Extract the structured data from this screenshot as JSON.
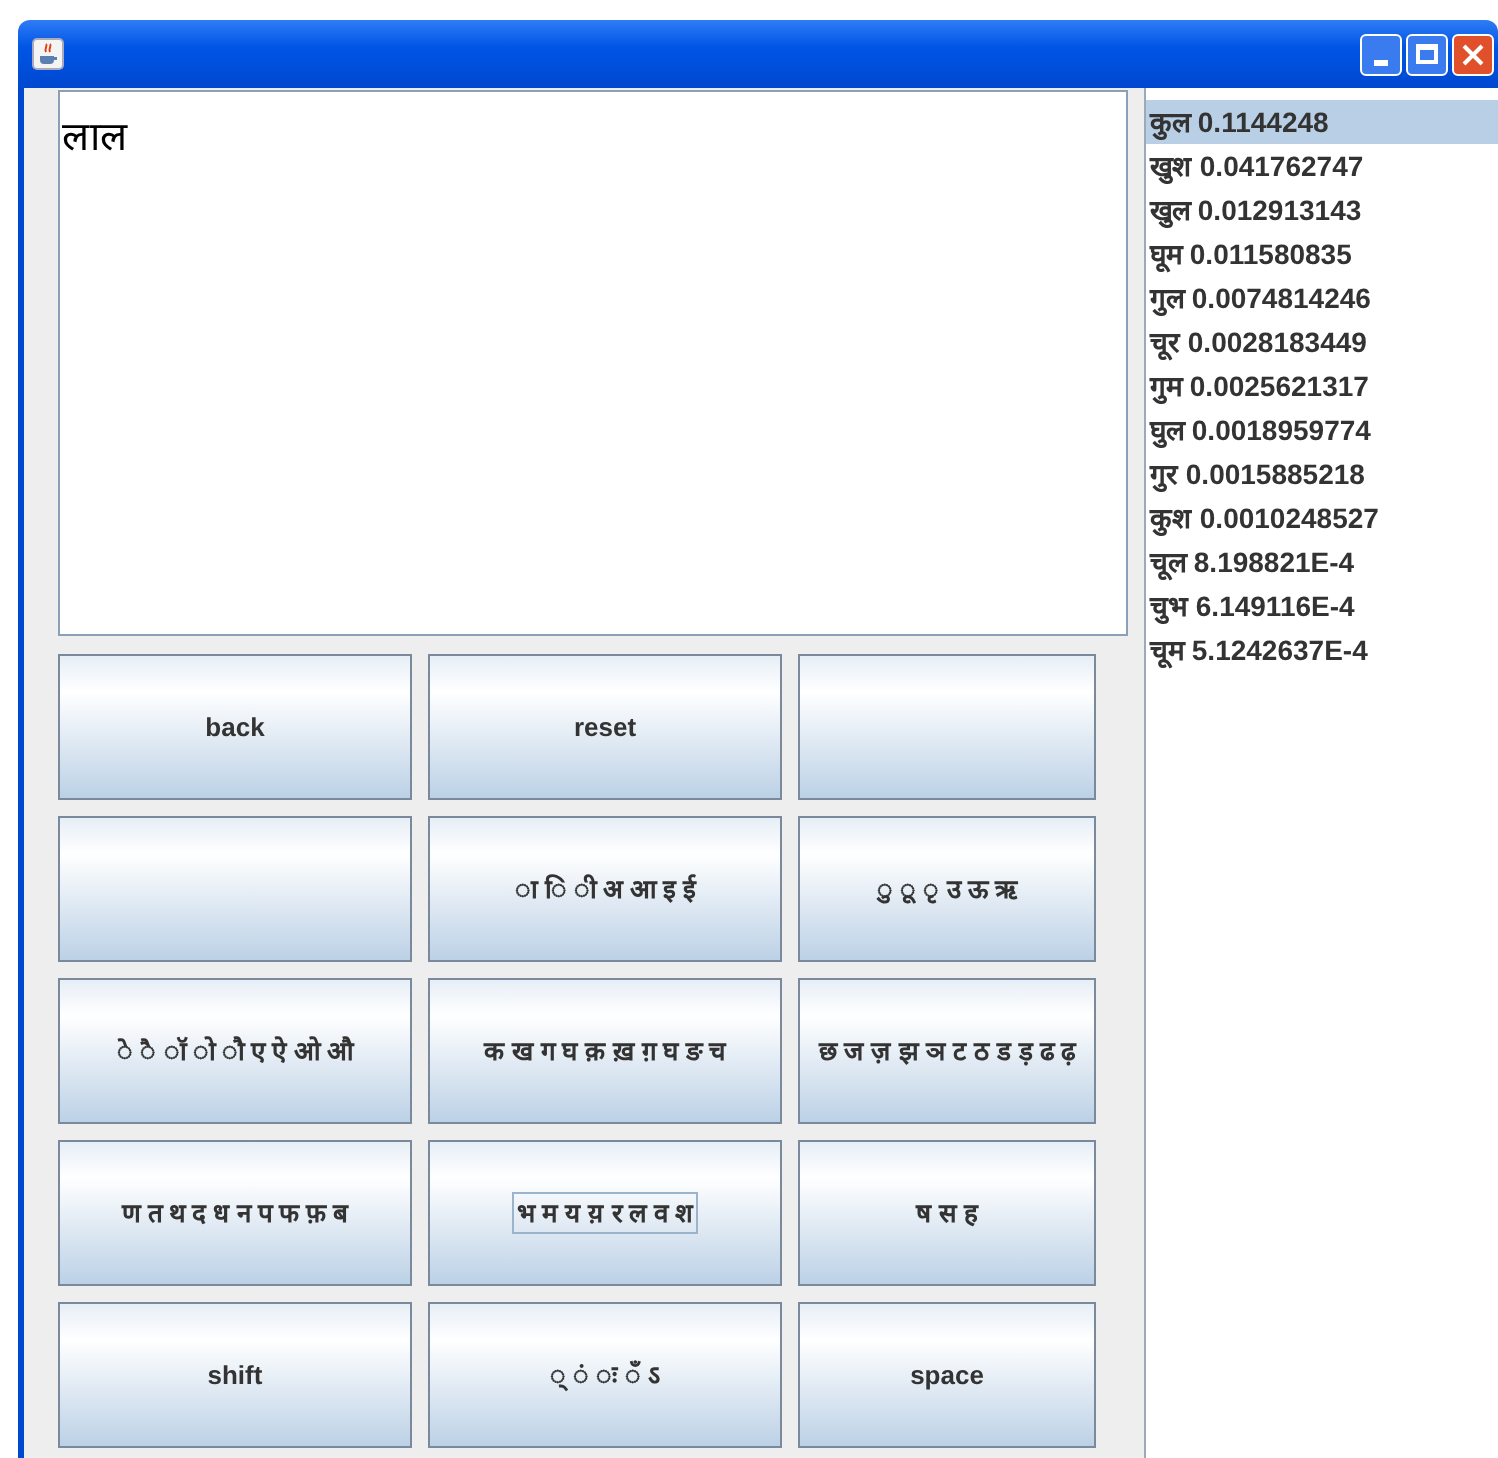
{
  "text_area": {
    "value": "लाल"
  },
  "keys": [
    {
      "label": "back",
      "focused": false
    },
    {
      "label": "reset",
      "focused": false
    },
    {
      "focused": false
    },
    {
      "focused": false
    },
    {
      "label": "◌ा ◌ि ◌ी अ आ इ ई",
      "focused": false
    },
    {
      "label": "◌ु ◌ू ◌ृ उ ऊ ऋ",
      "focused": false
    },
    {
      "label": "◌े ◌ै ◌ॉ ◌ो ◌ौ ए ऐ ओ औ",
      "focused": false
    },
    {
      "label": "क ख ग घ क़ ख़ ग़ घ ङ च",
      "focused": false
    },
    {
      "label": "छ ज ज़ झ ञ ट ठ ड ड़ ढ ढ़",
      "focused": false
    },
    {
      "label": "ण त थ द ध न प फ फ़ ब",
      "focused": false
    },
    {
      "label": "भ म य य़ र ल व श",
      "focused": true
    },
    {
      "label": "ष स ह",
      "focused": false
    },
    {
      "label": "shift",
      "focused": false
    },
    {
      "label": "◌् ◌ं ◌ः ◌ँ ऽ",
      "focused": false
    },
    {
      "label": "space",
      "focused": false
    }
  ],
  "suggestions": [
    {
      "word": "कुल 0.1144248",
      "selected": true
    },
    {
      "word": "खुश 0.041762747",
      "selected": false
    },
    {
      "word": "खुल 0.012913143",
      "selected": false
    },
    {
      "word": "घूम 0.011580835",
      "selected": false
    },
    {
      "word": "गुल 0.0074814246",
      "selected": false
    },
    {
      "word": "चूर 0.0028183449",
      "selected": false
    },
    {
      "word": "गुम 0.0025621317",
      "selected": false
    },
    {
      "word": "घुल 0.0018959774",
      "selected": false
    },
    {
      "word": "गुर 0.0015885218",
      "selected": false
    },
    {
      "word": "कुश 0.0010248527",
      "selected": false
    },
    {
      "word": "चूल 8.198821E-4",
      "selected": false
    },
    {
      "word": "चुभ 6.149116E-4",
      "selected": false
    },
    {
      "word": "चूम 5.1242637E-4",
      "selected": false
    }
  ]
}
